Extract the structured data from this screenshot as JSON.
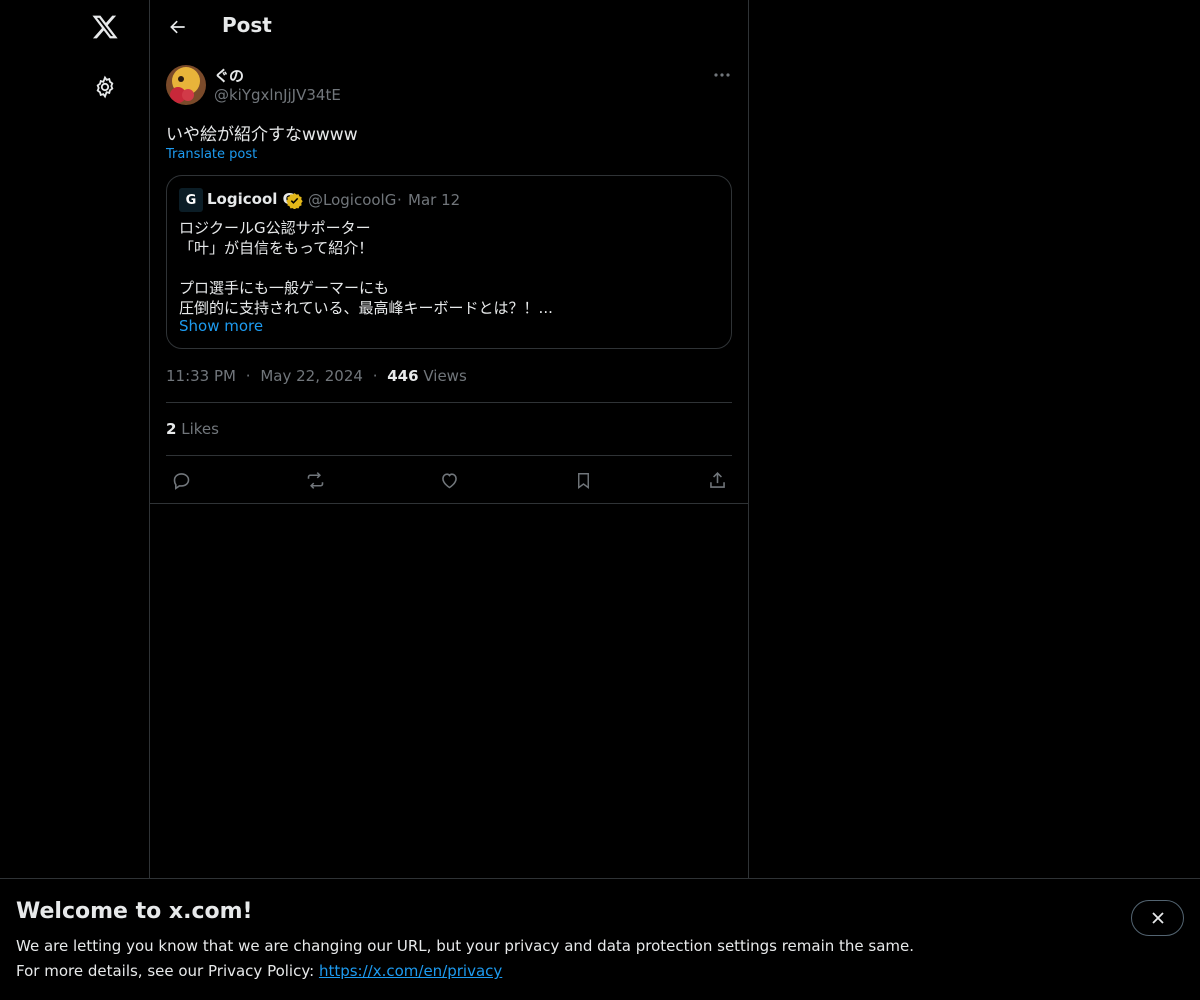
{
  "header": {
    "title": "Post"
  },
  "post": {
    "author_name": "ぐの",
    "author_handle": "@kiYgxlnJjJV34tE",
    "text": "いや絵が紹介すなwwww",
    "translate_label": "Translate post",
    "time": "11:33 PM",
    "date": "May 22, 2024",
    "views_count": "446",
    "views_label": "Views",
    "likes_count": "2",
    "likes_label": "Likes"
  },
  "quote": {
    "logo_glyph": "G",
    "name": "Logicool G",
    "handle": "@LogicoolG",
    "separator": "·",
    "date": "Mar 12",
    "lines": [
      "ロジクールG公認サポーター",
      "「叶」が自信をもって紹介！",
      "",
      "プロ選手にも一般ゲーマーにも",
      "圧倒的に支持されている、最高峰キーボードとは？！..."
    ],
    "show_more": "Show more"
  },
  "banner": {
    "title": "Welcome to x.com!",
    "line1": "We are letting you know that we are changing our URL, but your privacy and data protection settings remain the same.",
    "line2_prefix": "For more details, see our Privacy Policy: ",
    "link": "https://x.com/en/privacy"
  },
  "meta_separator": "·",
  "colors": {
    "accent": "#1d9bf0",
    "verified_gold": "#e2b719",
    "background": "#000000",
    "border": "#2f3336",
    "secondary_text": "#71767b"
  }
}
